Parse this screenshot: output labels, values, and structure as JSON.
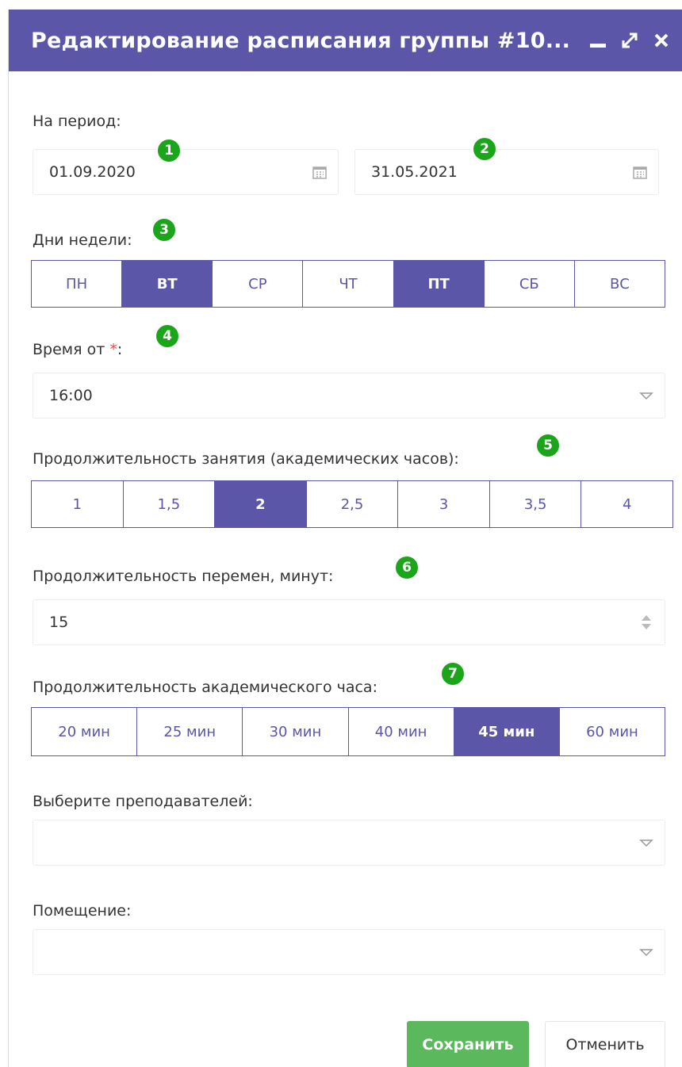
{
  "dialog": {
    "title": "Редактирование расписания группы #10...",
    "header_color": "#5b56a8"
  },
  "period": {
    "label": "На период:",
    "start": "01.09.2020",
    "end": "31.05.2021",
    "badge_start": "1",
    "badge_end": "2"
  },
  "weekdays": {
    "label": "Дни недели:",
    "badge": "3",
    "items": [
      {
        "label": "ПН",
        "active": false
      },
      {
        "label": "ВТ",
        "active": true
      },
      {
        "label": "СР",
        "active": false
      },
      {
        "label": "ЧТ",
        "active": false
      },
      {
        "label": "ПТ",
        "active": true
      },
      {
        "label": "СБ",
        "active": false
      },
      {
        "label": "ВС",
        "active": false
      }
    ]
  },
  "time_from": {
    "label": "Время от ",
    "required_mark": "*",
    "label_suffix": ":",
    "value": "16:00",
    "badge": "4"
  },
  "lesson_duration": {
    "label": "Продолжительность занятия (академических часов):",
    "badge": "5",
    "items": [
      {
        "label": "1",
        "active": false
      },
      {
        "label": "1,5",
        "active": false
      },
      {
        "label": "2",
        "active": true
      },
      {
        "label": "2,5",
        "active": false
      },
      {
        "label": "3",
        "active": false
      },
      {
        "label": "3,5",
        "active": false
      },
      {
        "label": "4",
        "active": false
      }
    ]
  },
  "break_duration": {
    "label": "Продолжительность перемен, минут:",
    "value": "15",
    "badge": "6"
  },
  "academic_hour": {
    "label": "Продолжительность академического часа:",
    "badge": "7",
    "items": [
      {
        "label": "20 мин",
        "active": false
      },
      {
        "label": "25 мин",
        "active": false
      },
      {
        "label": "30 мин",
        "active": false
      },
      {
        "label": "40 мин",
        "active": false
      },
      {
        "label": "45 мин",
        "active": true
      },
      {
        "label": "60 мин",
        "active": false
      }
    ]
  },
  "teachers": {
    "label": "Выберите преподавателей:",
    "value": ""
  },
  "room": {
    "label": "Помещение:",
    "value": ""
  },
  "buttons": {
    "save": "Сохранить",
    "cancel": "Отменить"
  },
  "colors": {
    "accent": "#5b56a8",
    "badge": "#1aa51a",
    "save": "#5cb85c",
    "required": "#e24c4c"
  }
}
